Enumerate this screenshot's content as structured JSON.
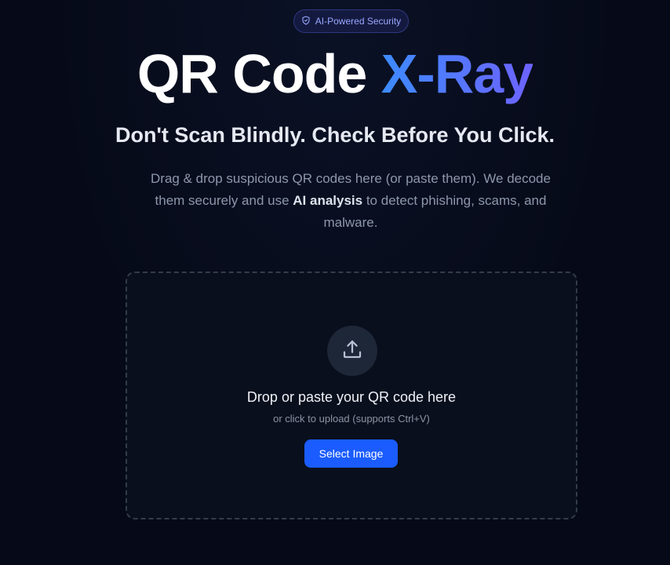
{
  "badge": {
    "icon": "shield-icon",
    "label": "AI-Powered Security"
  },
  "hero": {
    "title_main": "QR Code ",
    "title_accent": "X-Ray",
    "subtitle": "Don't Scan Blindly. Check Before You Click.",
    "description_before": "Drag & drop suspicious QR codes here (or paste them). We decode them securely and use ",
    "description_bold": "AI analysis",
    "description_after": " to detect phishing, scams, and malware."
  },
  "dropzone": {
    "icon": "upload-icon",
    "title": "Drop or paste your QR code here",
    "hint": "or click to upload (supports Ctrl+V)",
    "button_label": "Select Image"
  },
  "colors": {
    "background": "#060a18",
    "accent_start": "#3d8bff",
    "accent_end": "#6d63ff",
    "button": "#1a5cff",
    "badge_text": "#9aa6ff"
  }
}
